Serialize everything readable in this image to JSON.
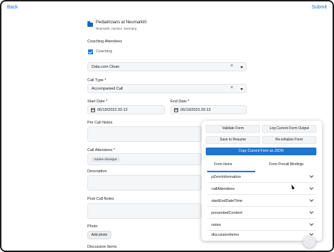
{
  "nav": {
    "back_label": "Back",
    "submit_label": "Submit"
  },
  "location": {
    "name": "Pediatricians at Neumarkt0",
    "address": "Neumarkt, Aachen, Germany",
    "icon": "folder-icon"
  },
  "coaching": {
    "section_label": "Coaching Attendees",
    "checkbox_label": "Coaching",
    "checked": true
  },
  "selector": {
    "value": "Data.com Clean"
  },
  "call_type": {
    "label": "Call Type *",
    "value": "Accompanied Call"
  },
  "dates": {
    "start_label": "Start Date *",
    "start_value": "06/19/2023 20:13",
    "end_label": "End Date *",
    "end_value": "06/19/2023 20:13"
  },
  "pre_call_notes": {
    "label": "Pre Call Notes"
  },
  "attendees": {
    "label": "Call Attendees *",
    "chip": "Karlee Abreique"
  },
  "description": {
    "label": "Description"
  },
  "post_call_notes": {
    "label": "Post Call Notes"
  },
  "photo": {
    "label": "Photo",
    "button_label": "Add photo"
  },
  "discussion": {
    "label": "Discussion Items"
  },
  "panel": {
    "validate_label": "Validate Form",
    "log_label": "Log Current Form Output",
    "save_label": "Save to Resume",
    "reinit_label": "Re-initialize Form",
    "copy_label": "Copy Current Form as JSON",
    "tabs": [
      "Form Items",
      "Form Precall Bindings"
    ],
    "items": [
      "pZeroInformation",
      "callAttendees",
      "startEndDateTime",
      "presentedContent",
      "notes",
      "discussionItems"
    ]
  },
  "colors": {
    "accent": "#1a73e8",
    "primary_button": "#1976d2"
  }
}
